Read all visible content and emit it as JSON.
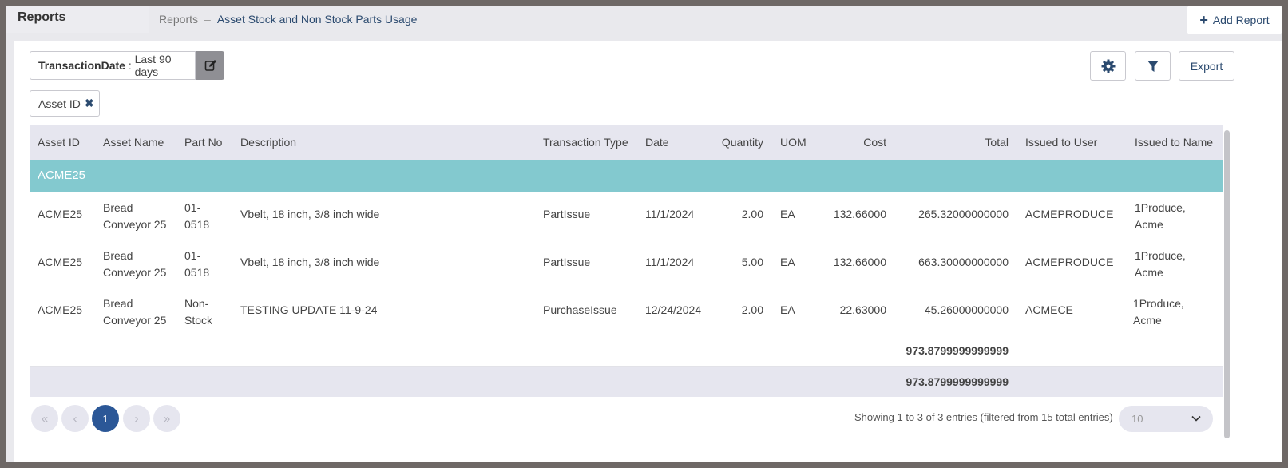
{
  "header": {
    "title": "Reports",
    "breadcrumb_root": "Reports",
    "breadcrumb_sep": "–",
    "breadcrumb_current": "Asset Stock and Non Stock Parts Usage",
    "add_report_label": "Add Report"
  },
  "filter": {
    "key": "TransactionDate",
    "sep": ":",
    "value": "Last 90 days"
  },
  "chip": {
    "label": "Asset ID"
  },
  "toolbar": {
    "export_label": "Export"
  },
  "table": {
    "columns": [
      "Asset ID",
      "Asset Name",
      "Part No",
      "Description",
      "Transaction Type",
      "Date",
      "Quantity",
      "UOM",
      "Cost",
      "Total",
      "Issued to User",
      "Issued to Name"
    ],
    "group_label": "ACME25",
    "rows": [
      {
        "asset_id": "ACME25",
        "asset_name_1": "Bread",
        "asset_name_2": "Conveyor 25",
        "part_1": "01-",
        "part_2": "0518",
        "description": "Vbelt, 18 inch, 3/8 inch wide",
        "type": "PartIssue",
        "date": "11/1/2024",
        "qty": "2.00",
        "uom": "EA",
        "cost": "132.66000",
        "total": "265.32000000000",
        "user": "ACMEPRODUCE",
        "name_1": "1Produce,",
        "name_2": "Acme"
      },
      {
        "asset_id": "ACME25",
        "asset_name_1": "Bread",
        "asset_name_2": "Conveyor 25",
        "part_1": "01-",
        "part_2": "0518",
        "description": "Vbelt, 18 inch, 3/8 inch wide",
        "type": "PartIssue",
        "date": "11/1/2024",
        "qty": "5.00",
        "uom": "EA",
        "cost": "132.66000",
        "total": "663.30000000000",
        "user": "ACMEPRODUCE",
        "name_1": "1Produce,",
        "name_2": "Acme"
      },
      {
        "asset_id": "ACME25",
        "asset_name_1": "Bread",
        "asset_name_2": "Conveyor 25",
        "part_1": "Non-",
        "part_2": "Stock",
        "description": "TESTING UPDATE 11-9-24",
        "type": "PurchaseIssue",
        "date": "12/24/2024",
        "qty": "2.00",
        "uom": "EA",
        "cost": "22.63000",
        "total": "45.26000000000",
        "user": "ACMECE",
        "name_1": "1Produce,",
        "name_2": "Acme"
      }
    ],
    "subtotal": "973.8799999999999",
    "grand_total": "973.8799999999999"
  },
  "pager": {
    "current_page": "1",
    "info": "Showing 1 to 3 of 3 entries (filtered from 15 total entries)",
    "page_size": "10"
  },
  "icons": [
    "plus-icon",
    "edit-icon",
    "close-icon",
    "gear-icon",
    "filter-icon",
    "first-page-icon",
    "prev-page-icon",
    "next-page-icon",
    "last-page-icon",
    "chevron-down-icon"
  ],
  "colors": {
    "accent": "#2b5797",
    "group_row": "#83c9cf",
    "header_row": "#e6e6ef"
  }
}
